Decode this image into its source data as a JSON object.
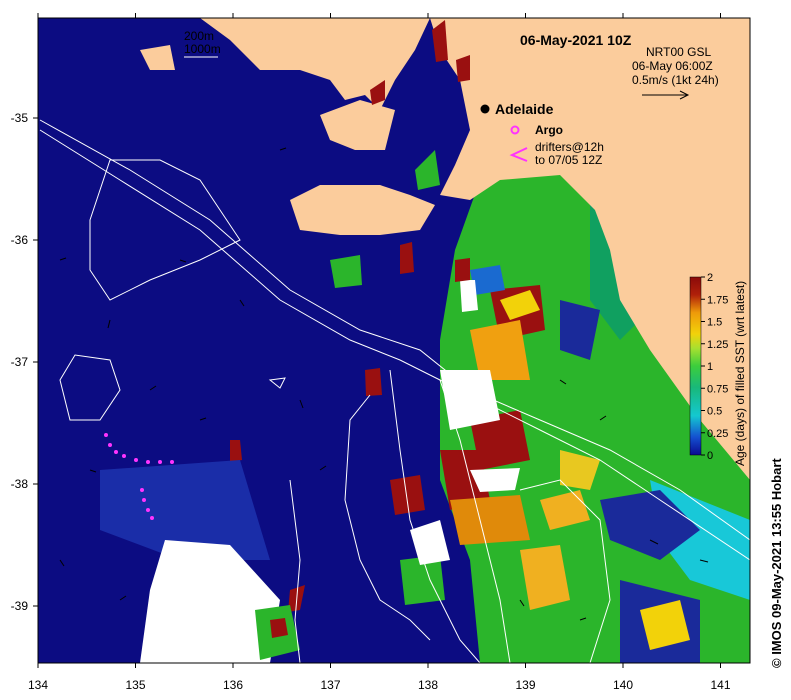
{
  "title": "06-May-2021 10Z",
  "current_product": {
    "name": "NRT00 GSL",
    "time": "06-May 06:00Z",
    "scale": "0.5m/s (1kt 24h)"
  },
  "depth_legend": [
    "200m",
    "1000m"
  ],
  "city": "Adelaide",
  "argo_label": "Argo",
  "drifter_label": [
    "drifters@12h",
    "to 07/05 12Z"
  ],
  "credit": "© IMOS 09-May-2021 13:55 Hobart",
  "colorbar": {
    "title": "Age (days) of filled SST (wrt latest)",
    "ticks": [
      "2",
      "1.75",
      "1.5",
      "1.25",
      "1",
      "0.75",
      "0.5",
      "0.25",
      "0"
    ],
    "colors": [
      "#8b0a0a",
      "#b0200a",
      "#d05a05",
      "#ee9a0a",
      "#f2d20a",
      "#a8e030",
      "#3cce3c",
      "#19b87a",
      "#14c8d0",
      "#1a8fe0",
      "#1450d0",
      "#0a0a90"
    ]
  },
  "axes": {
    "x_ticks": [
      "134",
      "135",
      "136",
      "137",
      "138",
      "139",
      "140",
      "141"
    ],
    "y_ticks": [
      "-35",
      "-36",
      "-37",
      "-38",
      "-39"
    ]
  },
  "colors": {
    "land": "#fbcc9c",
    "ocean_latest": "#0c0c82",
    "missing": "#ffffff",
    "argo": "#ff33ff",
    "drifters": "#ff33ff"
  }
}
